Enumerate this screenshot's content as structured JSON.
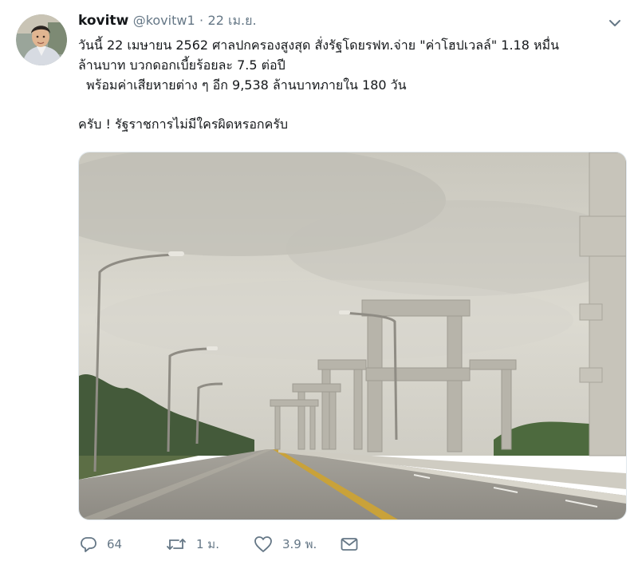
{
  "author": {
    "name": "kovitw",
    "handle": "@kovitw1",
    "separator": "·",
    "time": "22 เม.ย."
  },
  "tweet": {
    "lines": [
      "วันนี้ 22 เมษายน 2562 ศาลปกครองสูงสุด สั่งรัฐโดยรฟท.จ่าย \"ค่าโฮปเวลล์\" 1.18 หมื่น",
      "ล้านบาท บวกดอกเบี้ยร้อยละ 7.5 ต่อปี",
      "  พร้อมค่าเสียหายต่าง ๆ อีก 9,538 ล้านบาทภายใน 180 วัน",
      "ครับ ! รัฐราชการไม่มีใครผิดหรอกครับ"
    ]
  },
  "actions": {
    "reply_count": "64",
    "retweet_count": "1 ม.",
    "like_count": "3.9 พ."
  },
  "icons": {
    "reply": "reply-icon",
    "retweet": "retweet-icon",
    "like": "heart-icon",
    "dm": "mail-icon",
    "menu": "chevron-down-icon"
  },
  "colors": {
    "text": "#14171a",
    "secondary": "#657786",
    "border": "#e1e8ed"
  }
}
